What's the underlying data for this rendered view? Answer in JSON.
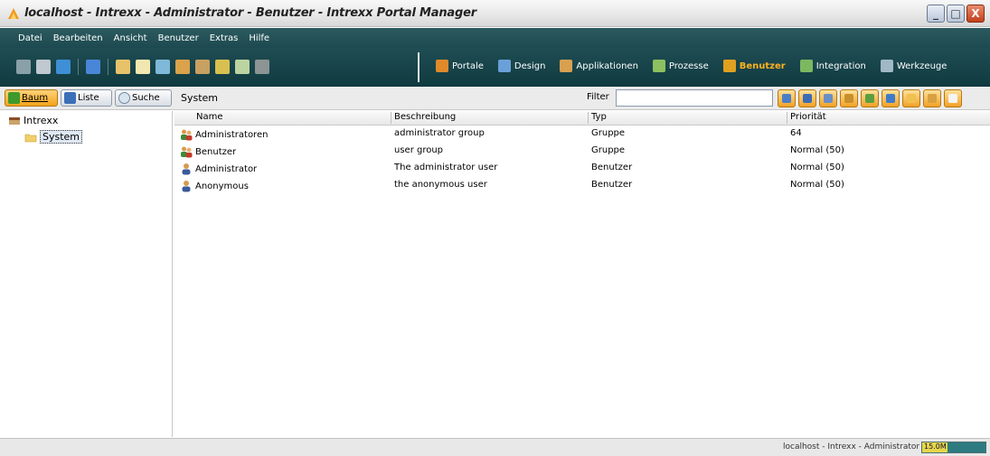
{
  "window": {
    "title": "localhost - Intrexx - Administrator - Benutzer - Intrexx Portal Manager",
    "min_label": "_",
    "max_label": "□",
    "close_label": "X"
  },
  "menu": [
    "Datei",
    "Bearbeiten",
    "Ansicht",
    "Benutzer",
    "Extras",
    "Hilfe"
  ],
  "toolbar": {
    "icons": [
      {
        "name": "disk-icon",
        "color": "#8aa0a8"
      },
      {
        "name": "print-icon",
        "color": "#c0c8d0"
      },
      {
        "name": "globe-icon",
        "color": "#3f8fd6"
      },
      {
        "name": "help-icon",
        "color": "#4a86d8"
      },
      {
        "name": "database-icon",
        "color": "#e7c26a"
      },
      {
        "name": "document-icon",
        "color": "#f2e7b0"
      },
      {
        "name": "connect-icon",
        "color": "#7fb8d8"
      },
      {
        "name": "users-icon",
        "color": "#d9a24b"
      },
      {
        "name": "tools-icon",
        "color": "#c8a060"
      },
      {
        "name": "wizard-icon",
        "color": "#d8c050"
      },
      {
        "name": "edit-icon",
        "color": "#bcd4a0"
      },
      {
        "name": "disabled-icon",
        "color": "#8c9494"
      }
    ],
    "modules": [
      {
        "label": "Portale",
        "icon": "portal-icon",
        "color": "#e08a2a",
        "active": false
      },
      {
        "label": "Design",
        "icon": "design-icon",
        "color": "#6aa0d8",
        "active": false
      },
      {
        "label": "Applikationen",
        "icon": "applications-icon",
        "color": "#d8a050",
        "active": false
      },
      {
        "label": "Prozesse",
        "icon": "processes-icon",
        "color": "#8cc060",
        "active": false
      },
      {
        "label": "Benutzer",
        "icon": "users-module-icon",
        "color": "#e0a020",
        "active": true
      },
      {
        "label": "Integration",
        "icon": "integration-icon",
        "color": "#7cb860",
        "active": false
      },
      {
        "label": "Werkzeuge",
        "icon": "tools-module-icon",
        "color": "#a0b8c8",
        "active": false
      }
    ]
  },
  "subbar": {
    "buttons": [
      {
        "label": "Baum",
        "active": true
      },
      {
        "label": "Liste",
        "active": false
      },
      {
        "label": "Suche",
        "active": false
      }
    ],
    "breadcrumb": "System",
    "filter_label": "Filter",
    "filter_value": "",
    "action_icons": [
      "new-user-icon",
      "new-group-icon",
      "new-role-icon",
      "new-container-icon",
      "new-set-icon",
      "properties-icon",
      "folder-icon",
      "import-icon",
      "export-icon"
    ]
  },
  "tree": {
    "root": "Intrexx",
    "child": "System"
  },
  "list": {
    "columns": [
      "Name",
      "Beschreibung",
      "Typ",
      "Priorität"
    ],
    "rows": [
      {
        "name": "Administratoren",
        "description": "administrator group",
        "type": "Gruppe",
        "priority": "64",
        "icon": "group-icon"
      },
      {
        "name": "Benutzer",
        "description": "user group",
        "type": "Gruppe",
        "priority": "Normal (50)",
        "icon": "group-icon"
      },
      {
        "name": "Administrator",
        "description": "The administrator user",
        "type": "Benutzer",
        "priority": "Normal (50)",
        "icon": "user-icon"
      },
      {
        "name": "Anonymous",
        "description": "the anonymous user",
        "type": "Benutzer",
        "priority": "Normal (50)",
        "icon": "user-icon"
      }
    ]
  },
  "status": {
    "text": "localhost - Intrexx - Administrator",
    "memory": "15.0M",
    "memory_fraction": 0.4
  },
  "colors": {
    "menubar": "#1d4a50",
    "active_module": "#ffb21e",
    "active_button": "#f4a31b"
  }
}
